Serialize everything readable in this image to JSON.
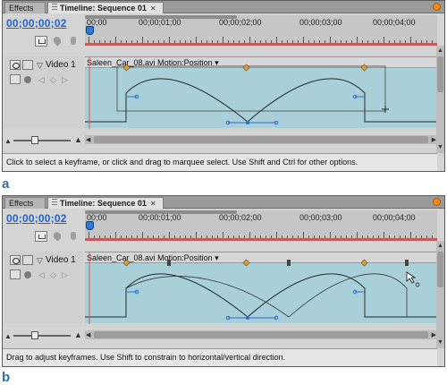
{
  "panels": [
    {
      "caption": "a",
      "tabs": {
        "effects": "Effects",
        "timeline": "Timeline: Sequence 01",
        "close": "✕"
      },
      "timecode": "00;00;00;02",
      "ruler_labels": [
        "00;00",
        "00;00;01;00",
        "00;00;02;00",
        "00;00;03;00",
        "00;00;04;00"
      ],
      "track": {
        "name": "Video 1",
        "twirl": "▽"
      },
      "clip": {
        "name": "Saleen_Car_08.avi",
        "property": "Motion:Position ▾"
      },
      "status": "Click to select a keyframe, or click and drag to marquee select. Use Shift and Ctrl for other options."
    },
    {
      "caption": "b",
      "tabs": {
        "effects": "Effects",
        "timeline": "Timeline: Sequence 01",
        "close": "✕"
      },
      "timecode": "00;00;00;02",
      "ruler_labels": [
        "00;00",
        "00;00;01;00",
        "00;00;02;00",
        "00;00;03;00",
        "00;00;04;00"
      ],
      "track": {
        "name": "Video 1",
        "twirl": "▽"
      },
      "clip": {
        "name": "Saleen_Car_08.avi",
        "property": "Motion:Position ▾"
      },
      "status": "Drag to adjust keyframes. Use Shift to constrain to horizontal/vertical direction."
    }
  ],
  "colors": {
    "timecode": "#2563c7",
    "caption": "#2b6fb0",
    "track_bg": "#a9cfd9",
    "keyframe_gold": "#d9a030",
    "keyframe_dark": "#444444",
    "cti_line": "#e05050",
    "handle_blue": "#2a6fd0"
  },
  "icons": [
    "eye-icon",
    "lock-icon",
    "twirl-down-icon",
    "keyframe-prev-icon",
    "keyframe-add-icon",
    "keyframe-next-icon",
    "snap-icon",
    "marker-icon",
    "pointer-cursor-icon",
    "panel-menu-icon"
  ]
}
